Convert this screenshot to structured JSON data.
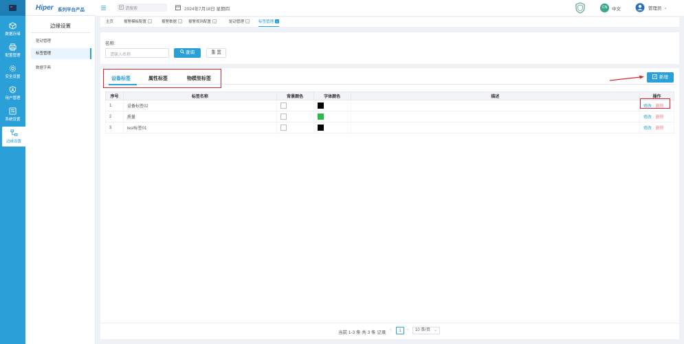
{
  "rail": {
    "items": [
      {
        "label": "数据存储",
        "icon": "cube-icon"
      },
      {
        "label": "配置管理",
        "icon": "printer-icon"
      },
      {
        "label": "安全设置",
        "icon": "gear-icon"
      },
      {
        "label": "用户管理",
        "icon": "shield-user-icon"
      },
      {
        "label": "系统设置",
        "icon": "settings-panel-icon"
      },
      {
        "label": "边缘设置",
        "icon": "edge-network-icon",
        "active": true
      }
    ]
  },
  "brand": {
    "name": "Hiper",
    "subtitle": "系列平台产品"
  },
  "subnav": {
    "title": "边缘设置",
    "items": [
      {
        "label": "驱动管理"
      },
      {
        "label": "标签管理",
        "active": true
      },
      {
        "label": "数据字典"
      }
    ]
  },
  "header": {
    "search_placeholder": "请搜索",
    "date": "2024年7月18日 星期四",
    "lang_badge": "CN",
    "lang_label": "中文",
    "user_label": "管理员"
  },
  "tabs": [
    {
      "label": "主页",
      "closable": false
    },
    {
      "label": "报警模板配置",
      "closable": true
    },
    {
      "label": "报警数据",
      "closable": true
    },
    {
      "label": "报警规则配置",
      "closable": true
    },
    {
      "label": "驱动管理",
      "closable": true
    },
    {
      "label": "标签管理",
      "closable": true,
      "active": true
    }
  ],
  "filter": {
    "name_label": "名称:",
    "name_placeholder": "请输入名称",
    "query_button": "查询",
    "reset_button": "重 置"
  },
  "subtabs": [
    {
      "label": "设备标签",
      "active": true
    },
    {
      "label": "属性标签"
    },
    {
      "label": "物模型标签"
    }
  ],
  "new_button": "新增",
  "table": {
    "columns": [
      "序号",
      "标签名称",
      "背景颜色",
      "字体颜色",
      "描述",
      "操作"
    ],
    "rows": [
      {
        "index": "1",
        "name": "设备标签02",
        "bg_color": "#ffffff",
        "font_color": "#000000",
        "description": ""
      },
      {
        "index": "2",
        "name": "质量",
        "bg_color": "#ffffff",
        "font_color": "#2db84a",
        "description": ""
      },
      {
        "index": "3",
        "name": "test标签01",
        "bg_color": "#ffffff",
        "font_color": "#000000",
        "description": ""
      }
    ],
    "edit_label": "修改",
    "delete_label": "删除"
  },
  "pagination": {
    "info": "当前 1-3 条 共 3 条 记录",
    "current_page": "1",
    "page_size": "10 条/页"
  },
  "colors": {
    "accent": "#2a9fd8",
    "highlight": "#d9232d",
    "delete": "#e8868a"
  }
}
